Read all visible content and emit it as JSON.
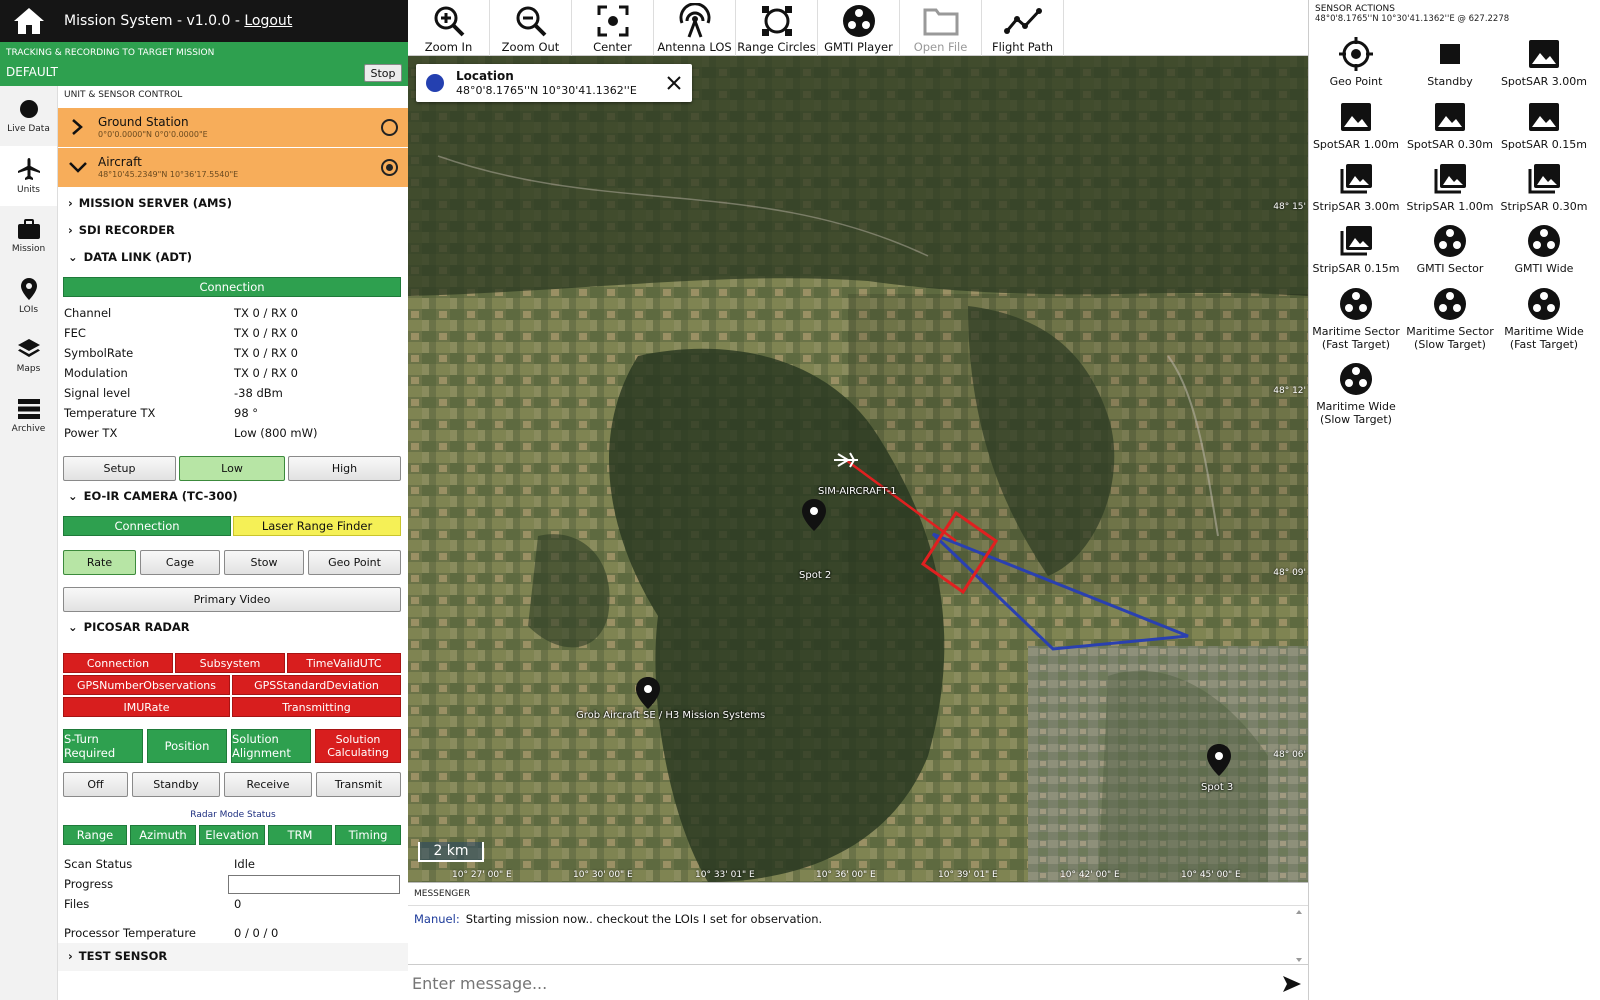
{
  "app": {
    "title": "Mission System - v1.0.0 - ",
    "logout_label": "Logout"
  },
  "tracking": {
    "title": "TRACKING & RECORDING TO TARGET MISSION",
    "mission": "DEFAULT",
    "stop_label": "Stop"
  },
  "nav": {
    "items": [
      {
        "label": "Live Data",
        "icon": "circle-icon"
      },
      {
        "label": "Units",
        "icon": "airplane-icon"
      },
      {
        "label": "Mission",
        "icon": "briefcase-icon"
      },
      {
        "label": "LOIs",
        "icon": "map-pin-icon"
      },
      {
        "label": "Maps",
        "icon": "layers-icon"
      },
      {
        "label": "Archive",
        "icon": "server-icon"
      }
    ],
    "active": "Units"
  },
  "units": {
    "section_label": "UNIT & SENSOR CONTROL",
    "items": [
      {
        "name": "Ground Station",
        "coord": "0°0'0.0000\"N 0°0'0.0000\"E",
        "selected": false
      },
      {
        "name": "Aircraft",
        "coord": "48°10'45.2349\"N 10°36'17.5540\"E",
        "selected": true
      }
    ]
  },
  "sections": {
    "mission_server": "MISSION SERVER (AMS)",
    "sdi_recorder": "SDI RECORDER",
    "data_link": "DATA LINK (ADT)",
    "eoir": "EO-IR CAMERA (TC-300)",
    "picosar": "PICOSAR RADAR",
    "test_sensor": "TEST SENSOR"
  },
  "data_link": {
    "connection_label": "Connection",
    "rows": [
      {
        "key": "Channel",
        "value": "TX 0 / RX 0"
      },
      {
        "key": "FEC",
        "value": "TX 0 / RX 0"
      },
      {
        "key": "SymbolRate",
        "value": "TX 0 / RX 0"
      },
      {
        "key": "Modulation",
        "value": "TX 0 / RX 0"
      },
      {
        "key": "Signal level",
        "value": "-38 dBm"
      },
      {
        "key": "Temperature TX",
        "value": "98 °"
      },
      {
        "key": "Power TX",
        "value": "Low (800 mW)"
      }
    ],
    "buttons": [
      "Setup",
      "Low",
      "High"
    ],
    "active_button": "Low"
  },
  "eoir": {
    "connection_label": "Connection",
    "laser_label": "Laser Range Finder",
    "buttons": [
      "Rate",
      "Cage",
      "Stow",
      "Geo Point"
    ],
    "active_button": "Rate",
    "primary_video_label": "Primary Video"
  },
  "picosar": {
    "status_row1": [
      "Connection",
      "Subsystem",
      "TimeValidUTC"
    ],
    "status_row2": [
      "GPSNumberObservations",
      "GPSStandardDeviation"
    ],
    "status_row3": [
      "IMURate",
      "Transmitting"
    ],
    "nav_status": [
      {
        "label": "S-Turn Required",
        "state": "ok"
      },
      {
        "label": "Position",
        "state": "ok"
      },
      {
        "label": "Solution Alignment",
        "state": "ok"
      },
      {
        "label": "Solution Calculating",
        "state": "error"
      }
    ],
    "mode_buttons": [
      "Off",
      "Standby",
      "Receive",
      "Transmit"
    ],
    "radar_mode_status_label": "Radar Mode Status",
    "mode_status": [
      "Range",
      "Azimuth",
      "Elevation",
      "TRM",
      "Timing"
    ],
    "scan_status": {
      "key": "Scan Status",
      "value": "Idle"
    },
    "progress": {
      "key": "Progress",
      "value": 0
    },
    "files": {
      "key": "Files",
      "value": "0"
    },
    "processor_temp": {
      "key": "Processor Temperature",
      "value": "0 / 0 / 0"
    }
  },
  "toolbar": {
    "items": [
      {
        "label": "Zoom In",
        "icon": "zoom-in-icon",
        "enabled": true
      },
      {
        "label": "Zoom Out",
        "icon": "zoom-out-icon",
        "enabled": true
      },
      {
        "label": "Center",
        "icon": "center-icon",
        "enabled": true
      },
      {
        "label": "Antenna LOS",
        "icon": "antenna-icon",
        "enabled": true
      },
      {
        "label": "Range Circles",
        "icon": "range-circles-icon",
        "enabled": true
      },
      {
        "label": "GMTI Player",
        "icon": "gmti-player-icon",
        "enabled": true
      },
      {
        "label": "Open File",
        "icon": "folder-icon",
        "enabled": false
      },
      {
        "label": "Flight Path",
        "icon": "flight-path-icon",
        "enabled": true
      }
    ]
  },
  "map": {
    "location_popup": {
      "title": "Location",
      "coord": "48°0'8.1765''N 10°30'41.1362''E"
    },
    "labels": {
      "aircraft": "SIM-AIRCRAFT-1",
      "spot2": "Spot 2",
      "spot3": "Spot 3",
      "grob": "Grob Aircraft SE / H3 Mission Systems"
    },
    "lat_labels": [
      "48° 15'",
      "48° 12'",
      "48° 09'",
      "48° 06'"
    ],
    "lon_labels": [
      "10° 27' 00\" E",
      "10° 30' 00\" E",
      "10° 33' 01\" E",
      "10° 36' 00\" E",
      "10° 39' 01\" E",
      "10° 42' 00\" E",
      "10° 45' 00\" E"
    ],
    "scale_label": "2 km",
    "colors": {
      "sar_footprint": "#e02020",
      "gmti_sector": "#2a40b0"
    }
  },
  "messenger": {
    "title": "MESSENGER",
    "messages": [
      {
        "author": "Manuel:",
        "text": "Starting mission now.. checkout the LOIs I set for observation."
      }
    ],
    "input_placeholder": "Enter message..."
  },
  "sensor_actions": {
    "title": "SENSOR ACTIONS",
    "coord": "48°0'8.1765''N 10°30'41.1362''E @ 627.2278",
    "items": [
      {
        "label": "Geo Point",
        "icon": "crosshair-icon"
      },
      {
        "label": "Standby",
        "icon": "square-icon"
      },
      {
        "label": "SpotSAR 3.00m",
        "icon": "image-icon"
      },
      {
        "label": "SpotSAR 1.00m",
        "icon": "image-icon"
      },
      {
        "label": "SpotSAR 0.30m",
        "icon": "image-icon"
      },
      {
        "label": "SpotSAR 0.15m",
        "icon": "image-icon"
      },
      {
        "label": "StripSAR 3.00m",
        "icon": "images-icon"
      },
      {
        "label": "StripSAR 1.00m",
        "icon": "images-icon"
      },
      {
        "label": "StripSAR 0.30m",
        "icon": "images-icon"
      },
      {
        "label": "StripSAR 0.15m",
        "icon": "images-icon"
      },
      {
        "label": "GMTI Sector",
        "icon": "radar-dots-icon"
      },
      {
        "label": "GMTI Wide",
        "icon": "radar-dots-icon"
      },
      {
        "label": "Maritime Sector (Fast Target)",
        "icon": "radar-dots-icon"
      },
      {
        "label": "Maritime Sector (Slow Target)",
        "icon": "radar-dots-icon"
      },
      {
        "label": "Maritime Wide (Fast Target)",
        "icon": "radar-dots-icon"
      },
      {
        "label": "Maritime Wide (Slow Target)",
        "icon": "radar-dots-icon"
      }
    ]
  }
}
